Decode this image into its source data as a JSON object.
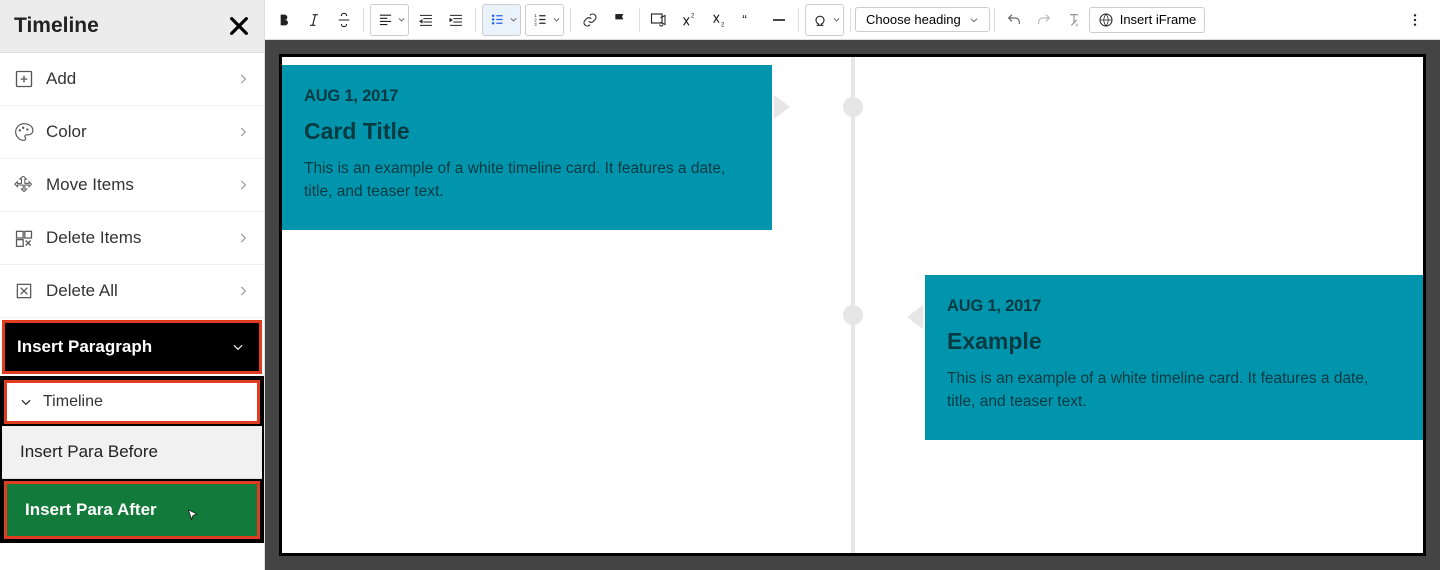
{
  "sidebar": {
    "title": "Timeline",
    "items": [
      {
        "label": "Add",
        "icon": "add-square-icon"
      },
      {
        "label": "Color",
        "icon": "palette-icon"
      },
      {
        "label": "Move Items",
        "icon": "move-icon"
      },
      {
        "label": "Delete Items",
        "icon": "delete-items-icon"
      },
      {
        "label": "Delete All",
        "icon": "delete-all-icon"
      }
    ],
    "insertParagraph": "Insert Paragraph",
    "subPanel": {
      "header": "Timeline",
      "before": "Insert Para Before",
      "after": "Insert Para After"
    }
  },
  "toolbar": {
    "heading": "Choose heading",
    "insertIframe": "Insert iFrame"
  },
  "timeline": {
    "cards": [
      {
        "date": "AUG 1, 2017",
        "title": "Card Title",
        "text": "This is an example of a white timeline card. It features a date, title, and teaser text."
      },
      {
        "date": "AUG 1, 2017",
        "title": "Example",
        "text": "This is an example of a white timeline card. It features a date, title, and teaser text."
      }
    ]
  }
}
